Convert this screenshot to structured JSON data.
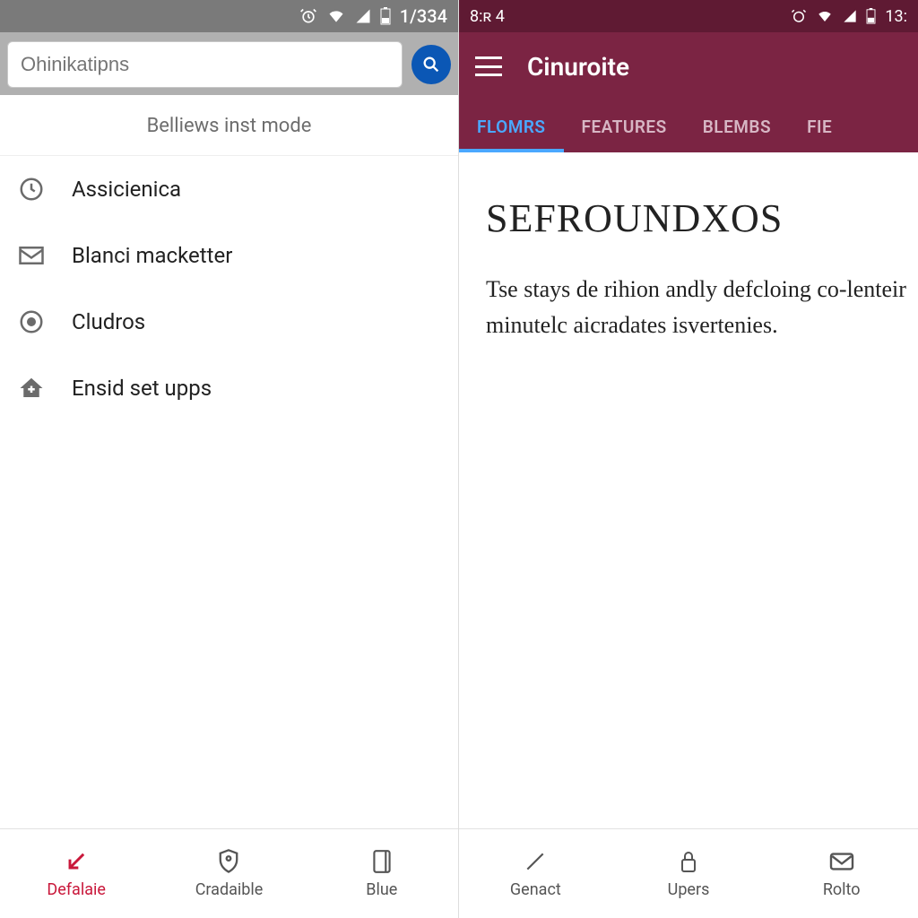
{
  "left": {
    "status": {
      "time": "1/334"
    },
    "search": {
      "placeholder": "Ohinikatipns"
    },
    "subheader": "Belliews inst mode",
    "items": [
      {
        "icon": "clock",
        "label": "Assicienica"
      },
      {
        "icon": "envelope",
        "label": "Blanci macketter"
      },
      {
        "icon": "target",
        "label": "Cludros"
      },
      {
        "icon": "home-plus",
        "label": "Ensid set upps"
      }
    ],
    "nav": [
      {
        "icon": "arrow-down-left",
        "label": "Defalaie",
        "active": true
      },
      {
        "icon": "shield",
        "label": "Cradaible",
        "active": false
      },
      {
        "icon": "book",
        "label": "Blue",
        "active": false
      }
    ]
  },
  "right": {
    "status": {
      "left": "8:ʀ 4",
      "right": "13:"
    },
    "title": "Cinuroite",
    "tabs": [
      {
        "label": "Flomrs",
        "active": true
      },
      {
        "label": "Features",
        "active": false
      },
      {
        "label": "Blembs",
        "active": false
      },
      {
        "label": "Fie",
        "active": false
      }
    ],
    "article": {
      "title": "SEFROUNDXOS",
      "body": "Tse stays de rihion andly defcloing co-lenteir minutelc aicradates isvertenies."
    },
    "nav": [
      {
        "icon": "pencil",
        "label": "Genact"
      },
      {
        "icon": "lock",
        "label": "Upers"
      },
      {
        "icon": "mail",
        "label": "Rolto"
      }
    ]
  }
}
